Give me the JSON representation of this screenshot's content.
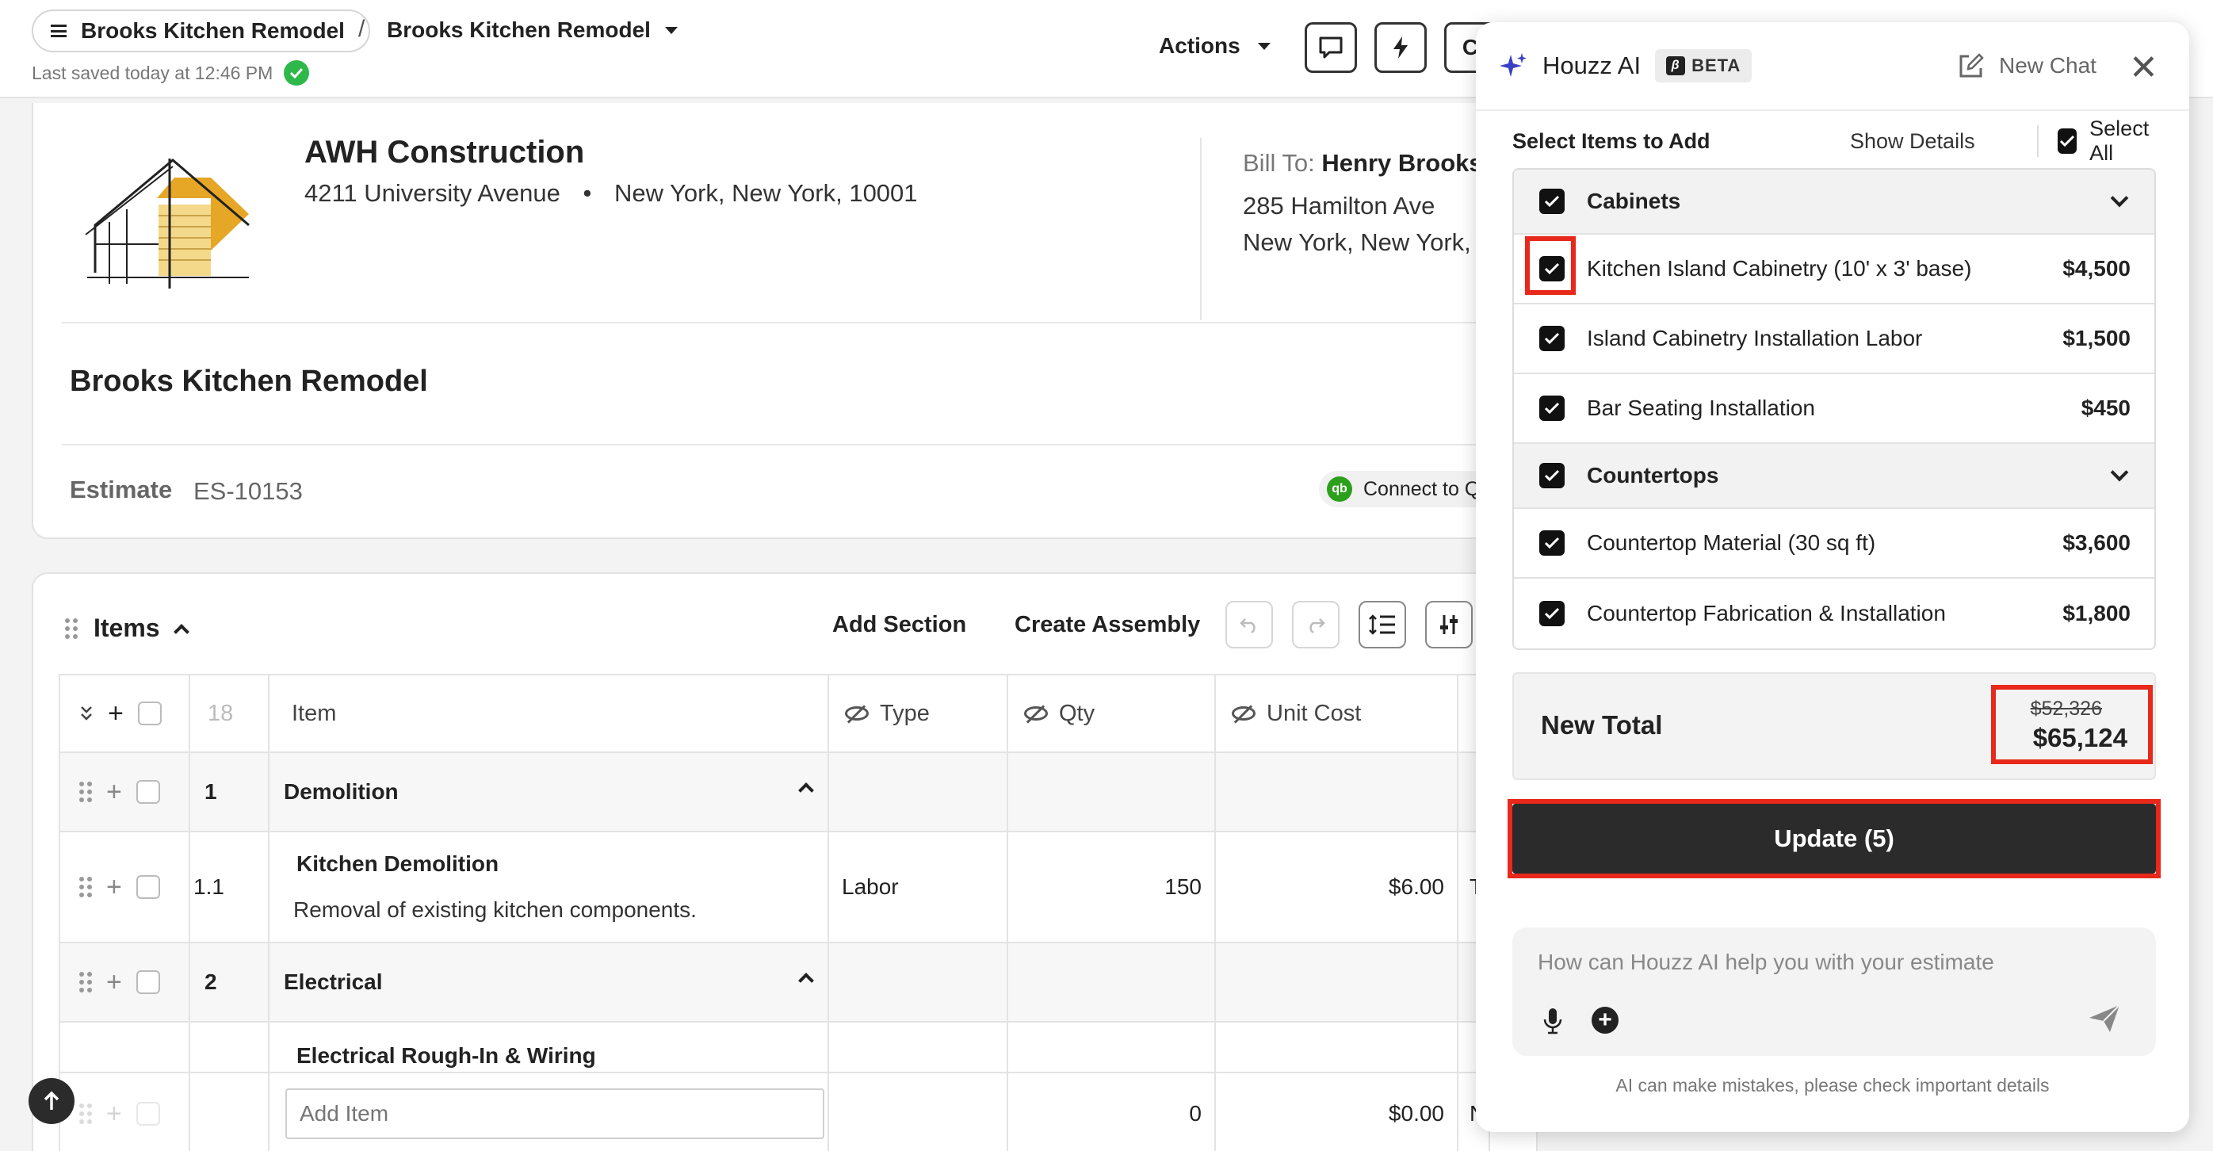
{
  "header": {
    "breadcrumb_project": "Brooks Kitchen Remodel",
    "breadcrumb_separator": "/",
    "breadcrumb_current": "Brooks Kitchen Remodel",
    "saved_status": "Last saved today at 12:46 PM",
    "actions_label": "Actions"
  },
  "company": {
    "name": "AWH Construction",
    "address": "4211 University Avenue",
    "city_state_zip": "New York, New York, 10001"
  },
  "bill_to": {
    "label": "Bill To:",
    "name": "Henry Brooks",
    "line1": "285 Hamilton Ave",
    "line2": "New York, New York,"
  },
  "project": {
    "title": "Brooks Kitchen Remodel",
    "estimate_label": "Estimate",
    "estimate_number": "ES-10153",
    "qb_logo": "qb",
    "qb_label": "Connect to Q"
  },
  "items": {
    "title": "Items",
    "add_section": "Add Section",
    "create_assembly": "Create Assembly",
    "count": "18",
    "columns": {
      "item": "Item",
      "type": "Type",
      "qty": "Qty",
      "unit_cost": "Unit Cost"
    },
    "rows": [
      {
        "num": "1",
        "name": "Demolition"
      },
      {
        "num": "1.1",
        "name": "Kitchen Demolition",
        "desc": "Removal of existing kitchen components.",
        "type": "Labor",
        "qty": "150",
        "unit_cost": "$6.00",
        "trail": "T"
      },
      {
        "num": "2",
        "name": "Electrical"
      },
      {
        "name": "Electrical Rough-In & Wiring"
      }
    ],
    "add_row": {
      "placeholder": "Add Item",
      "qty": "0",
      "unit_cost": "$0.00",
      "trail": "N"
    }
  },
  "ai_panel": {
    "title": "Houzz AI",
    "beta_icon": "β",
    "beta": "BETA",
    "new_chat": "New Chat",
    "close": "✕",
    "select_title": "Select Items to Add",
    "show_details": "Show Details",
    "select_all": "Select All",
    "groups": [
      {
        "name": "Cabinets",
        "items": [
          {
            "label": "Kitchen Island Cabinetry (10' x 3' base)",
            "price": "$4,500"
          },
          {
            "label": "Island Cabinetry Installation Labor",
            "price": "$1,500"
          },
          {
            "label": "Bar Seating Installation",
            "price": "$450"
          }
        ]
      },
      {
        "name": "Countertops",
        "items": [
          {
            "label": "Countertop Material (30 sq ft)",
            "price": "$3,600"
          },
          {
            "label": "Countertop Fabrication & Installation",
            "price": "$1,800"
          }
        ]
      }
    ],
    "new_total_label": "New Total",
    "old_total": "$52,326",
    "new_total": "$65,124",
    "update_button": "Update (5)",
    "chat_placeholder": "How can Houzz AI help you with your estimate",
    "disclaimer": "AI can make mistakes, please check important details"
  },
  "colors": {
    "highlight": "#e8281b",
    "success": "#2fb84a",
    "dark": "#2b2b2b",
    "logo_gold": "#e6a626",
    "ai_star": "#3b3fc4"
  },
  "icons": [
    "hamburger-icon",
    "chevron-down-icon",
    "check-circle-icon",
    "comment-icon",
    "lightning-icon",
    "drag-handle-icon",
    "chevron-up-icon",
    "undo-icon",
    "redo-icon",
    "line-spacing-icon",
    "column-settings-icon",
    "eye-off-icon",
    "sparkle-icon",
    "edit-icon",
    "close-icon",
    "checkbox-checked-icon",
    "mic-icon",
    "plus-circle-icon",
    "send-icon",
    "arrow-up-icon"
  ]
}
